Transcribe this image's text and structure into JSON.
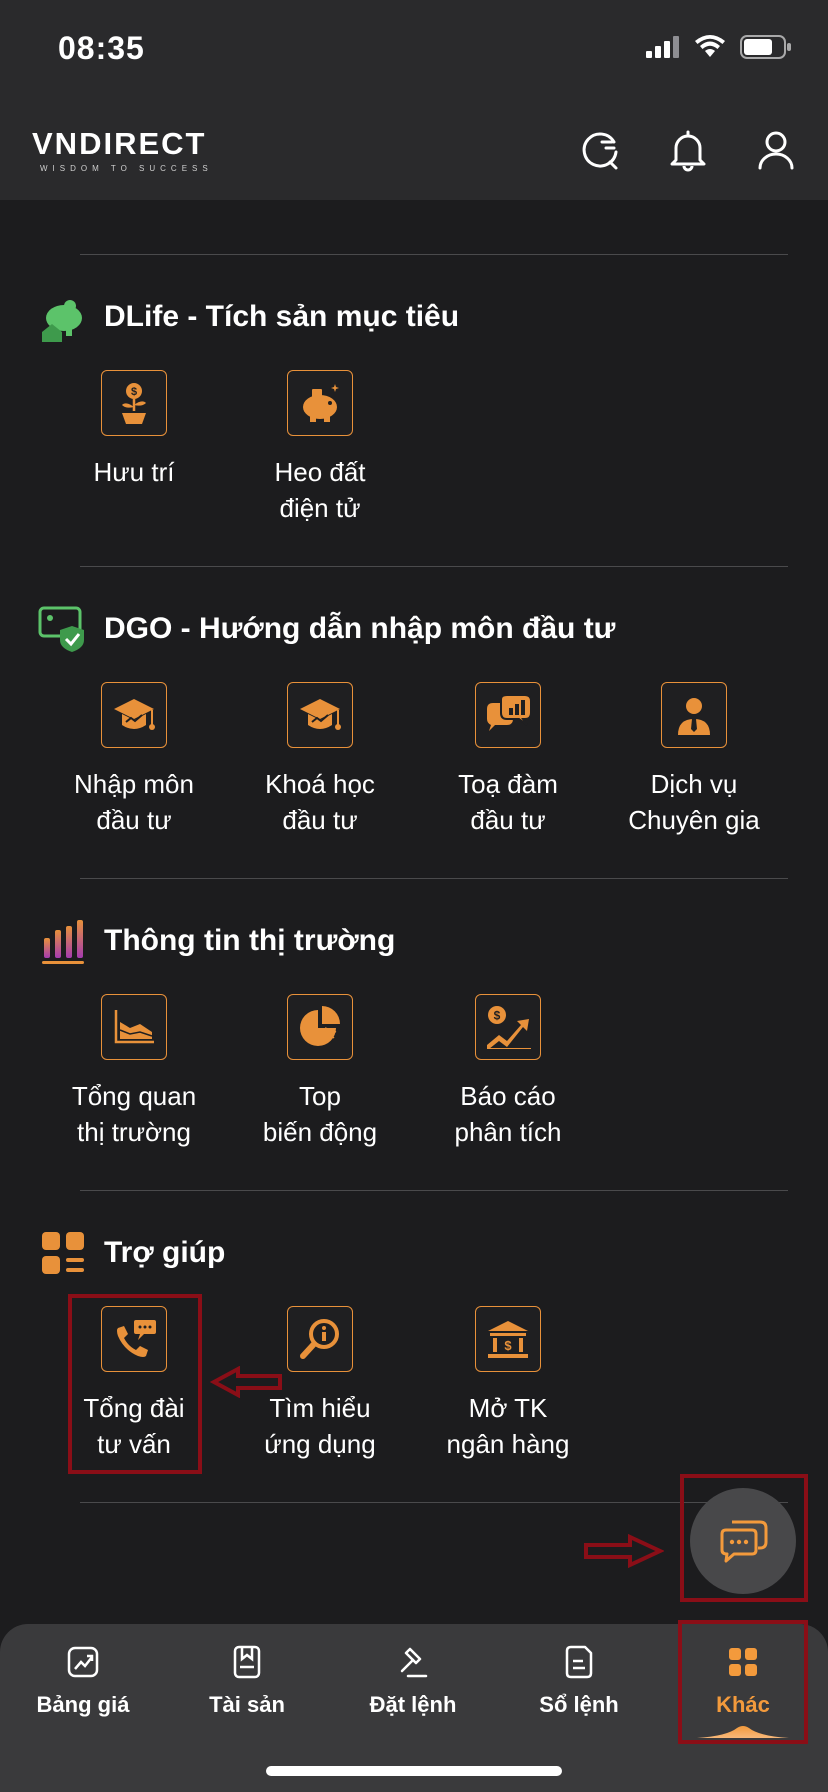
{
  "status": {
    "time": "08:35"
  },
  "header": {
    "logo_text": "VNDIRECT",
    "logo_tagline": "WISDOM TO SUCCESS"
  },
  "sections": [
    {
      "title": "DLife - Tích sản mục tiêu",
      "items": [
        {
          "label": "Hưu trí"
        },
        {
          "label": "Heo đất\nđiện tử"
        }
      ]
    },
    {
      "title": "DGO - Hướng dẫn nhập môn đầu tư",
      "items": [
        {
          "label": "Nhập môn\nđầu tư"
        },
        {
          "label": "Khoá học\nđầu tư"
        },
        {
          "label": "Toạ đàm\nđầu tư"
        },
        {
          "label": "Dịch vụ\nChuyên gia"
        }
      ]
    },
    {
      "title": "Thông tin thị trường",
      "items": [
        {
          "label": "Tổng quan\nthị trường"
        },
        {
          "label": "Top\nbiến động"
        },
        {
          "label": "Báo cáo\nphân tích"
        }
      ]
    },
    {
      "title": "Trợ giúp",
      "items": [
        {
          "label": "Tổng đài\ntư vấn"
        },
        {
          "label": "Tìm hiểu\nứng dụng"
        },
        {
          "label": "Mở TK\nngân hàng"
        }
      ]
    }
  ],
  "nav": [
    {
      "label": "Bảng giá"
    },
    {
      "label": "Tài sản"
    },
    {
      "label": "Đặt lệnh"
    },
    {
      "label": "Sổ lệnh"
    },
    {
      "label": "Khác"
    }
  ],
  "colors": {
    "accent": "#e8913a",
    "annotation": "#8a0e17",
    "background": "#1c1c1e"
  }
}
